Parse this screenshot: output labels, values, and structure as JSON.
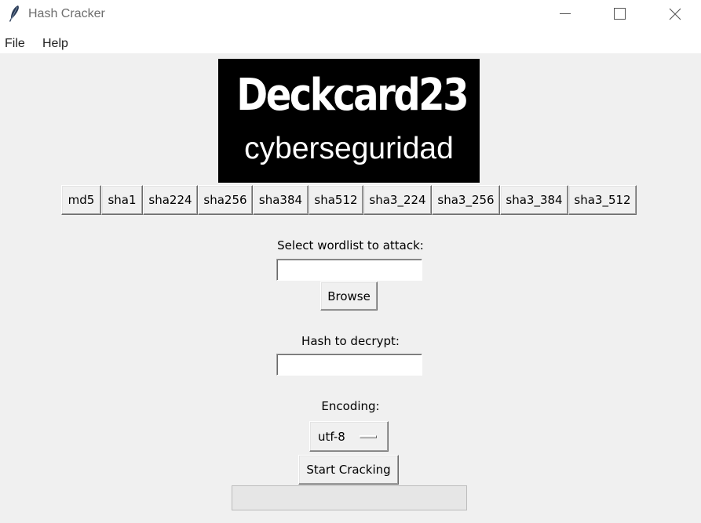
{
  "window": {
    "title": "Hash Cracker",
    "controls": [
      "minimize-icon",
      "maximize-icon",
      "close-icon"
    ]
  },
  "menu": {
    "items": [
      "File",
      "Help"
    ]
  },
  "logo": {
    "title": "Deckcard23",
    "subtitle": "cyberseguridad"
  },
  "hash_algorithms": [
    "md5",
    "sha1",
    "sha224",
    "sha256",
    "sha384",
    "sha512",
    "sha3_224",
    "sha3_256",
    "sha3_384",
    "sha3_512"
  ],
  "wordlist": {
    "label": "Select wordlist to attack:",
    "value": "",
    "browse_label": "Browse"
  },
  "hash": {
    "label": "Hash to decrypt:",
    "value": ""
  },
  "encoding": {
    "label": "Encoding:",
    "selected": "utf-8"
  },
  "start_label": "Start Cracking",
  "progress": {
    "fraction": 0
  },
  "colors": {
    "background": "#f0f0f0",
    "logo_background": "#000000",
    "logo_text": "#ffffff"
  }
}
